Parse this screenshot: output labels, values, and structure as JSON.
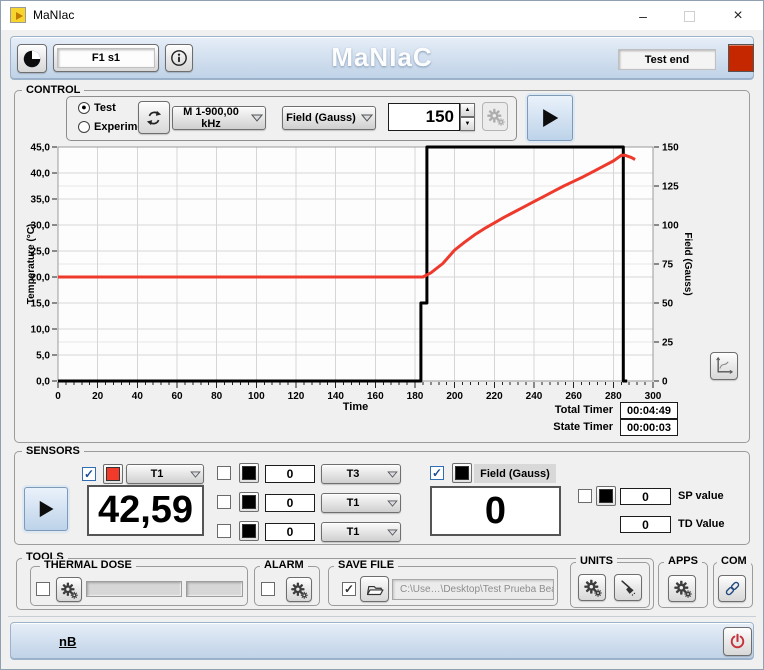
{
  "window": {
    "title": "MaNIac",
    "minimize_glyph": "–",
    "close_glyph": "×"
  },
  "header": {
    "app_title": "MaNIaC",
    "preset": "F1 s1",
    "status_label": "Test end",
    "status_color": "#c52700"
  },
  "control": {
    "label": "CONTROL",
    "modes": [
      {
        "label": "Test",
        "dot": "●"
      },
      {
        "label": "Experiment",
        "dot": ""
      }
    ],
    "frequency_dropdown": "M 1-900,00 kHz",
    "output_dropdown": "Field (Gauss)",
    "setpoint": "150",
    "timers": {
      "total_label": "Total Timer",
      "total_value": "00:04:49",
      "state_label": "State Timer",
      "state_value": "00:00:03"
    }
  },
  "chart_data": {
    "type": "line",
    "xlabel": "Time",
    "x_range": [
      0,
      300
    ],
    "x_major_step": 20,
    "x_minor_step": 4,
    "grid": true,
    "left_axis": {
      "label": "Temperature (°C)",
      "range": [
        0,
        45
      ],
      "major_step": 5,
      "tick_labels": [
        "0,0",
        "5,0",
        "10,0",
        "15,0",
        "20,0",
        "25,0",
        "30,0",
        "35,0",
        "40,0",
        "45,0"
      ]
    },
    "right_axis": {
      "label": "Field (Gauss)",
      "range": [
        0,
        150
      ],
      "major_step": 25,
      "tick_labels": [
        "0",
        "25",
        "50",
        "75",
        "100",
        "125",
        "150"
      ]
    },
    "series": [
      {
        "name": "Field (Gauss)",
        "axis": "right",
        "color": "#000000",
        "width": 3,
        "points": [
          [
            0,
            0
          ],
          [
            183,
            0
          ],
          [
            183,
            50
          ],
          [
            186,
            50
          ],
          [
            186,
            150
          ],
          [
            285,
            150
          ],
          [
            285,
            0
          ],
          [
            287,
            0
          ]
        ]
      },
      {
        "name": "Temperature",
        "axis": "left",
        "color": "#ee3a2c",
        "width": 3,
        "points": [
          [
            0,
            20
          ],
          [
            184,
            20
          ],
          [
            188,
            20.8
          ],
          [
            194,
            22.6
          ],
          [
            200,
            25.2
          ],
          [
            205,
            26.7
          ],
          [
            210,
            28.1
          ],
          [
            215,
            29.3
          ],
          [
            220,
            30.4
          ],
          [
            225,
            31.5
          ],
          [
            230,
            32.5
          ],
          [
            235,
            33.5
          ],
          [
            240,
            34.5
          ],
          [
            245,
            35.5
          ],
          [
            250,
            36.5
          ],
          [
            255,
            37.5
          ],
          [
            260,
            38.4
          ],
          [
            265,
            39.3
          ],
          [
            270,
            40.3
          ],
          [
            275,
            41.3
          ],
          [
            280,
            42.3
          ],
          [
            284,
            43.4
          ],
          [
            286,
            43.4
          ],
          [
            289,
            43
          ],
          [
            291,
            42.6
          ]
        ]
      }
    ]
  },
  "sensors": {
    "label": "SENSORS",
    "main": {
      "check": "✓",
      "color": "#f23a2b",
      "channel": "T1",
      "value": "42,59"
    },
    "aux": [
      {
        "check": "",
        "color": "#000000",
        "value": "0",
        "channel": "T3"
      },
      {
        "check": "",
        "color": "#000000",
        "value": "0",
        "channel": "T1"
      },
      {
        "check": "",
        "color": "#000000",
        "value": "0",
        "channel": "T1"
      }
    ],
    "field": {
      "check": "✓",
      "color": "#000000",
      "label": "Field (Gauss)",
      "value": "0"
    },
    "sp": {
      "check": "",
      "color": "#000000",
      "value": "0",
      "label": "SP value"
    },
    "td": {
      "value": "0",
      "label": "TD Value"
    }
  },
  "tools": {
    "label": "TOOLS",
    "thermal_dose": {
      "label": "THERMAL DOSE",
      "check": ""
    },
    "alarm": {
      "label": "ALARM",
      "check": ""
    },
    "save_file": {
      "label": "SAVE FILE",
      "check": "✓",
      "path": "C:\\Use…\\Desktop\\Test Prueba Bea.txt"
    },
    "units": {
      "label": "UNITS"
    },
    "apps": {
      "label": "APPS"
    },
    "com": {
      "label": "COM"
    }
  },
  "footer": {
    "link": "nB"
  },
  "icons": {
    "gear": "settings-gear",
    "folder": "open-folder",
    "broom": "clean-sweep",
    "link": "chain-link",
    "power": "power-off",
    "cycle": "refresh-cycle",
    "moon": "contrast-moon",
    "info": "information",
    "autoscale": "graph-scale"
  }
}
